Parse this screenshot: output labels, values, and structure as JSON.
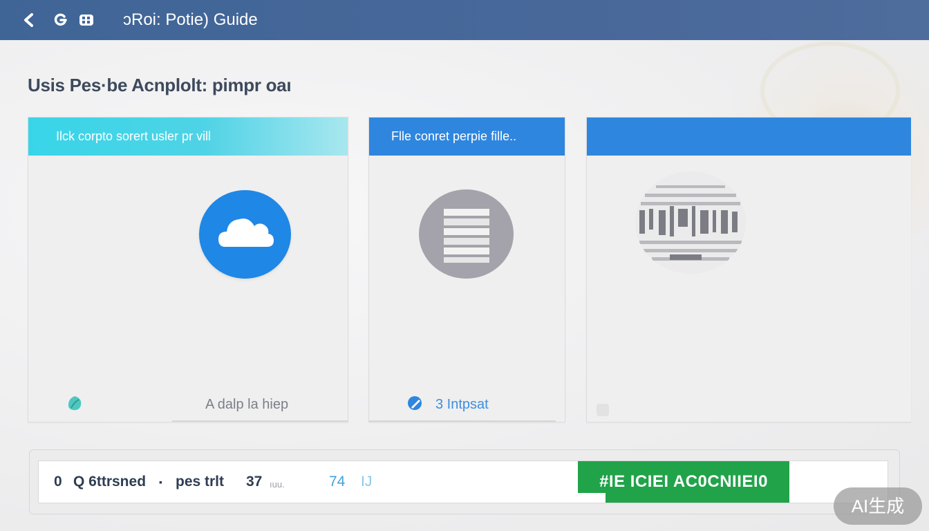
{
  "topbar": {
    "back_icon": "back-arrow-icon",
    "refresh_icon": "refresh-icon",
    "grid_icon": "grid-icon",
    "title": "ↄRoi: Potie) Guide"
  },
  "page": {
    "heading": "Usis Pes·be Acnplolt: pimpr oaı"
  },
  "cards": [
    {
      "header": "Ilck corpto sorert usler  pr vill",
      "icon": "cloud-icon",
      "footer_icon": "leaf-icon",
      "footer_text": "A dalp la hiep"
    },
    {
      "header": "Flle conret perpie fille..",
      "icon": "document-icon",
      "footer_icon": "pencil-icon",
      "footer_text": "3 Intpsat"
    },
    {
      "header": "",
      "icon": "barcode-icon"
    }
  ],
  "status": {
    "item1": "0",
    "item2": "Q 6ttrsned",
    "sep": "▪",
    "item3": "pes trlt",
    "item4": "37",
    "item4_unit": "ıuu.",
    "item5": "74",
    "item5_unit": "IJ",
    "action_label": "#IE ICIEI AC0CNIIEI0"
  },
  "watermark": "AI生成",
  "colors": {
    "topbar": "#44679a",
    "accent_blue": "#2f86de",
    "accent_cyan": "#38d5e8",
    "green": "#21a34a"
  }
}
